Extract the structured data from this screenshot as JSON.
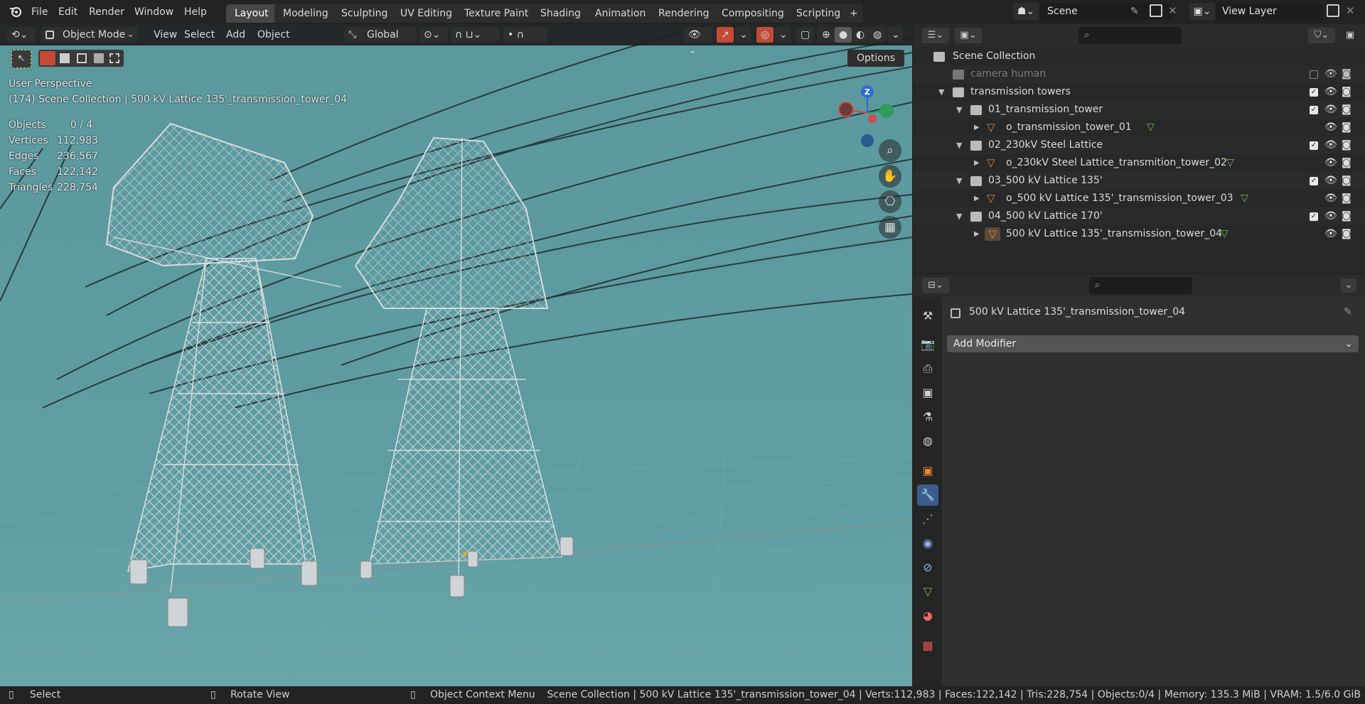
{
  "menu": [
    "File",
    "Edit",
    "Render",
    "Window",
    "Help"
  ],
  "workspaces": [
    "Layout",
    "Modeling",
    "Sculpting",
    "UV Editing",
    "Texture Paint",
    "Shading",
    "Animation",
    "Rendering",
    "Compositing",
    "Scripting"
  ],
  "active_workspace": "Layout",
  "add_workspace": "+",
  "scene": "Scene",
  "view_layer": "View Layer",
  "viewport": {
    "mode": "Object Mode",
    "menus": [
      "View",
      "Select",
      "Add",
      "Object"
    ],
    "transform_orientation": "Global",
    "options_label": "Options",
    "view_name": "User Perspective",
    "view_context": "(174) Scene Collection | 500 kV Lattice 135'_transmission_tower_04",
    "stats": [
      {
        "label": "Objects",
        "value": "0 / 4"
      },
      {
        "label": "Vertices",
        "value": "112,983"
      },
      {
        "label": "Edges",
        "value": "236,567"
      },
      {
        "label": "Faces",
        "value": "122,142"
      },
      {
        "label": "Triangles",
        "value": "228,754"
      }
    ],
    "gizmo_axis": "Z"
  },
  "outliner": {
    "root": "Scene Collection",
    "items": [
      {
        "label": "camera human",
        "depth": 1,
        "kind": "collection",
        "dim": true
      },
      {
        "label": "transmission towers",
        "depth": 1,
        "kind": "collection"
      },
      {
        "label": "01_transmission_tower",
        "depth": 2,
        "kind": "collection"
      },
      {
        "label": "o_transmission_tower_01",
        "depth": 3,
        "kind": "object"
      },
      {
        "label": "02_230kV Steel Lattice",
        "depth": 2,
        "kind": "collection"
      },
      {
        "label": "o_230kV Steel Lattice_transmition_tower_02",
        "depth": 3,
        "kind": "object"
      },
      {
        "label": "03_500 kV Lattice 135'",
        "depth": 2,
        "kind": "collection"
      },
      {
        "label": "o_500 kV Lattice 135'_transmission_tower_03",
        "depth": 3,
        "kind": "object"
      },
      {
        "label": "04_500 kV Lattice 170'",
        "depth": 2,
        "kind": "collection"
      },
      {
        "label": "500 kV Lattice 135'_transmission_tower_04",
        "depth": 3,
        "kind": "object",
        "selected": true
      }
    ]
  },
  "properties": {
    "object_name": "500 kV Lattice 135'_transmission_tower_04",
    "add_modifier": "Add Modifier"
  },
  "statusbar": {
    "left": [
      {
        "icon": "mouse-left-icon",
        "label": "Select"
      },
      {
        "icon": "mouse-middle-icon",
        "label": "Rotate View"
      },
      {
        "icon": "mouse-right-icon",
        "label": "Object Context Menu"
      }
    ],
    "info": "Scene Collection | 500 kV Lattice 135'_transmission_tower_04 | Verts:112,983 | Faces:122,142 | Tris:228,754 | Objects:0/4 | Memory: 135.3 MiB | VRAM: 1.5/6.0 GiB"
  },
  "colors": {
    "viewport_bg": "#5c9aa0",
    "accent_orange": "#e8833a",
    "selection_blue": "#334d80",
    "active_tab": "#474747",
    "gizmo_x": "#d54a4a",
    "gizmo_y": "#2e9e5a",
    "gizmo_z": "#2e6ed0"
  }
}
